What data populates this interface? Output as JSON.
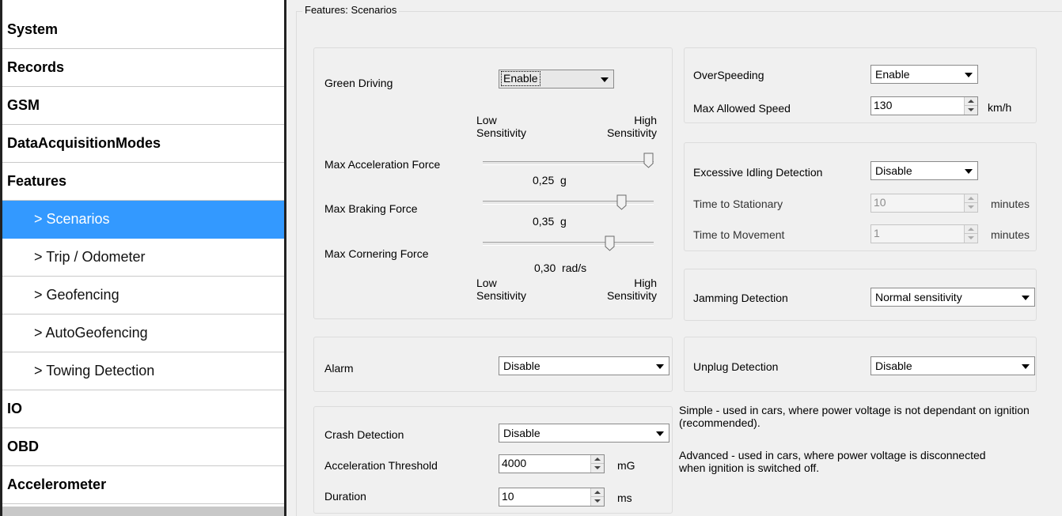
{
  "sidebar": {
    "items": [
      {
        "label": "System",
        "type": "main"
      },
      {
        "label": "Records",
        "type": "main"
      },
      {
        "label": "GSM",
        "type": "main"
      },
      {
        "label": "DataAcquisitionModes",
        "type": "main"
      },
      {
        "label": "Features",
        "type": "main"
      },
      {
        "label": "> Scenarios",
        "type": "sub",
        "selected": true
      },
      {
        "label": "> Trip / Odometer",
        "type": "sub"
      },
      {
        "label": "> Geofencing",
        "type": "sub"
      },
      {
        "label": "> AutoGeofencing",
        "type": "sub"
      },
      {
        "label": "> Towing Detection",
        "type": "sub"
      },
      {
        "label": "IO",
        "type": "main"
      },
      {
        "label": "OBD",
        "type": "main"
      },
      {
        "label": "Accelerometer",
        "type": "main"
      }
    ],
    "selected_color": "#3399ff"
  },
  "group_title": "Features: Scenarios",
  "green_driving": {
    "label": "Green Driving",
    "value": "Enable",
    "low_sensitivity": "Low\nSensitivity",
    "high_sensitivity": "High\nSensitivity",
    "sliders": [
      {
        "label": "Max Acceleration Force",
        "value": "0,25",
        "unit": "g",
        "position": 1.0
      },
      {
        "label": "Max Braking Force",
        "value": "0,35",
        "unit": "g",
        "position": 0.8
      },
      {
        "label": "Max Cornering Force",
        "value": "0,30",
        "unit": "rad/s",
        "position": 0.7
      }
    ]
  },
  "overspeeding": {
    "label": "OverSpeeding",
    "value": "Enable",
    "max_speed_label": "Max Allowed Speed",
    "max_speed_value": "130",
    "max_speed_unit": "km/h"
  },
  "idling": {
    "label": "Excessive Idling Detection",
    "value": "Disable",
    "stationary_label": "Time to Stationary",
    "stationary_value": "10",
    "stationary_unit": "minutes",
    "movement_label": "Time to Movement",
    "movement_value": "1",
    "movement_unit": "minutes"
  },
  "jamming": {
    "label": "Jamming Detection",
    "value": "Normal sensitivity"
  },
  "alarm": {
    "label": "Alarm",
    "value": "Disable"
  },
  "unplug": {
    "label": "Unplug Detection",
    "value": "Disable"
  },
  "crash": {
    "label": "Crash Detection",
    "value": "Disable",
    "threshold_label": "Acceleration Threshold",
    "threshold_value": "4000",
    "threshold_unit": "mG",
    "duration_label": "Duration",
    "duration_value": "10",
    "duration_unit": "ms"
  },
  "info": {
    "simple": "Simple - used in cars, where power voltage is not dependant on ignition (recommended).",
    "advanced": "Advanced - used in cars, where power voltage is disconnected when ignition is switched off."
  }
}
